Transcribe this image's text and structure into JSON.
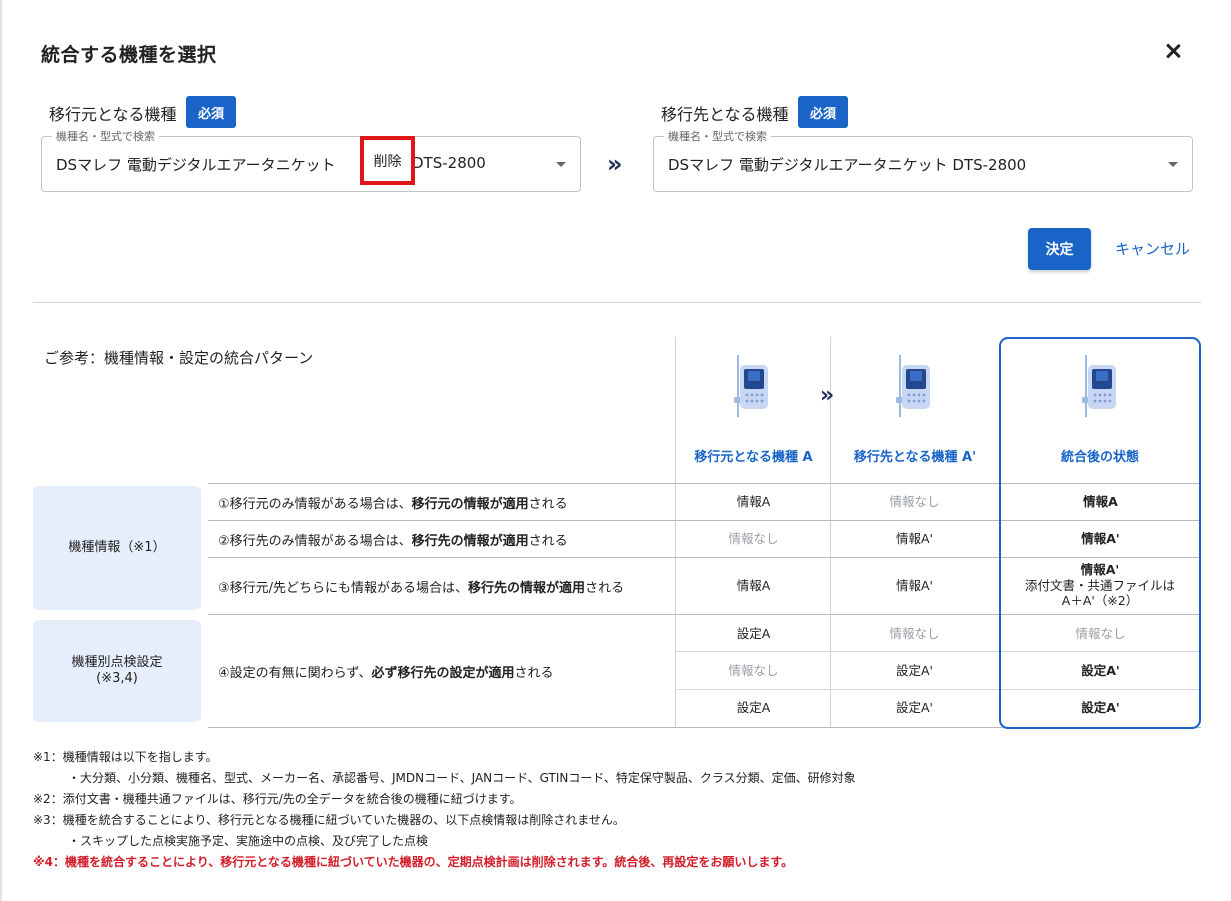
{
  "dialog": {
    "title": "統合する機種を選択",
    "close_icon": "close-icon"
  },
  "source": {
    "label": "移行元となる機種",
    "required": "必須",
    "legend": "機種名・型式で検索",
    "value_prefix": "DSマレフ 電動デジタルエアータニケット",
    "delete_badge": "削除",
    "value_suffix": "DTS-2800"
  },
  "target": {
    "label": "移行先となる機種",
    "required": "必須",
    "legend": "機種名・型式で検索",
    "value": "DSマレフ 電動デジタルエアータニケット DTS-2800"
  },
  "actions": {
    "ok": "決定",
    "cancel": "キャンセル"
  },
  "reference": {
    "title": "ご参考：機種情報・設定の統合パターン",
    "columns": [
      "移行元となる機種 A",
      "移行先となる機種 A'",
      "統合後の状態"
    ],
    "groups": {
      "model_info": "機種情報（※1）",
      "inspection": "機種別点検設定",
      "inspection_note": "(※3,4)"
    },
    "rules": [
      {
        "pre": "①移行元のみ情報がある場合は、",
        "bold": "移行元の情報が適用",
        "post": "される"
      },
      {
        "pre": "②移行先のみ情報がある場合は、",
        "bold": "移行先の情報が適用",
        "post": "される"
      },
      {
        "pre": "③移行元/先どちらにも情報がある場合は、",
        "bold": "移行先の情報が適用",
        "post": "される"
      },
      {
        "pre": "④設定の有無に関わらず、",
        "bold": "必ず移行先の設定が適用",
        "post": "される"
      }
    ],
    "rows": [
      [
        "情報A",
        "情報なし",
        "情報A"
      ],
      [
        "情報なし",
        "情報A'",
        "情報A'"
      ],
      [
        "情報A",
        "情報A'",
        "情報A'"
      ],
      [
        "設定A",
        "情報なし",
        "情報なし"
      ],
      [
        "情報なし",
        "設定A'",
        "設定A'"
      ],
      [
        "設定A",
        "設定A'",
        "設定A'"
      ]
    ],
    "row3_extra_1": "添付文書・共通ファイルは",
    "row3_extra_2": "A＋A'（※2）"
  },
  "notes": [
    "※1：機種情報は以下を指します。",
    "・大分類、小分類、機種名、型式、メーカー名、承認番号、JMDNコード、JANコード、GTINコード、特定保守製品、クラス分類、定価、研修対象",
    "※2：添付文書・機種共通ファイルは、移行元/先の全データを統合後の機種に紐づけます。",
    "※3：機種を統合することにより、移行元となる機種に紐づいていた機器の、以下点検情報は削除されません。",
    "・スキップした点検実施予定、実施途中の点検、及び完了した点検",
    "※4：機種を統合することにより、移行元となる機種に紐づいていた機器の、定期点検計画は削除されます。統合後、再設定をお願いします。"
  ],
  "colors": {
    "accent": "#1a64c8",
    "danger": "#d21f2b",
    "group_bg": "#e6eefc"
  }
}
